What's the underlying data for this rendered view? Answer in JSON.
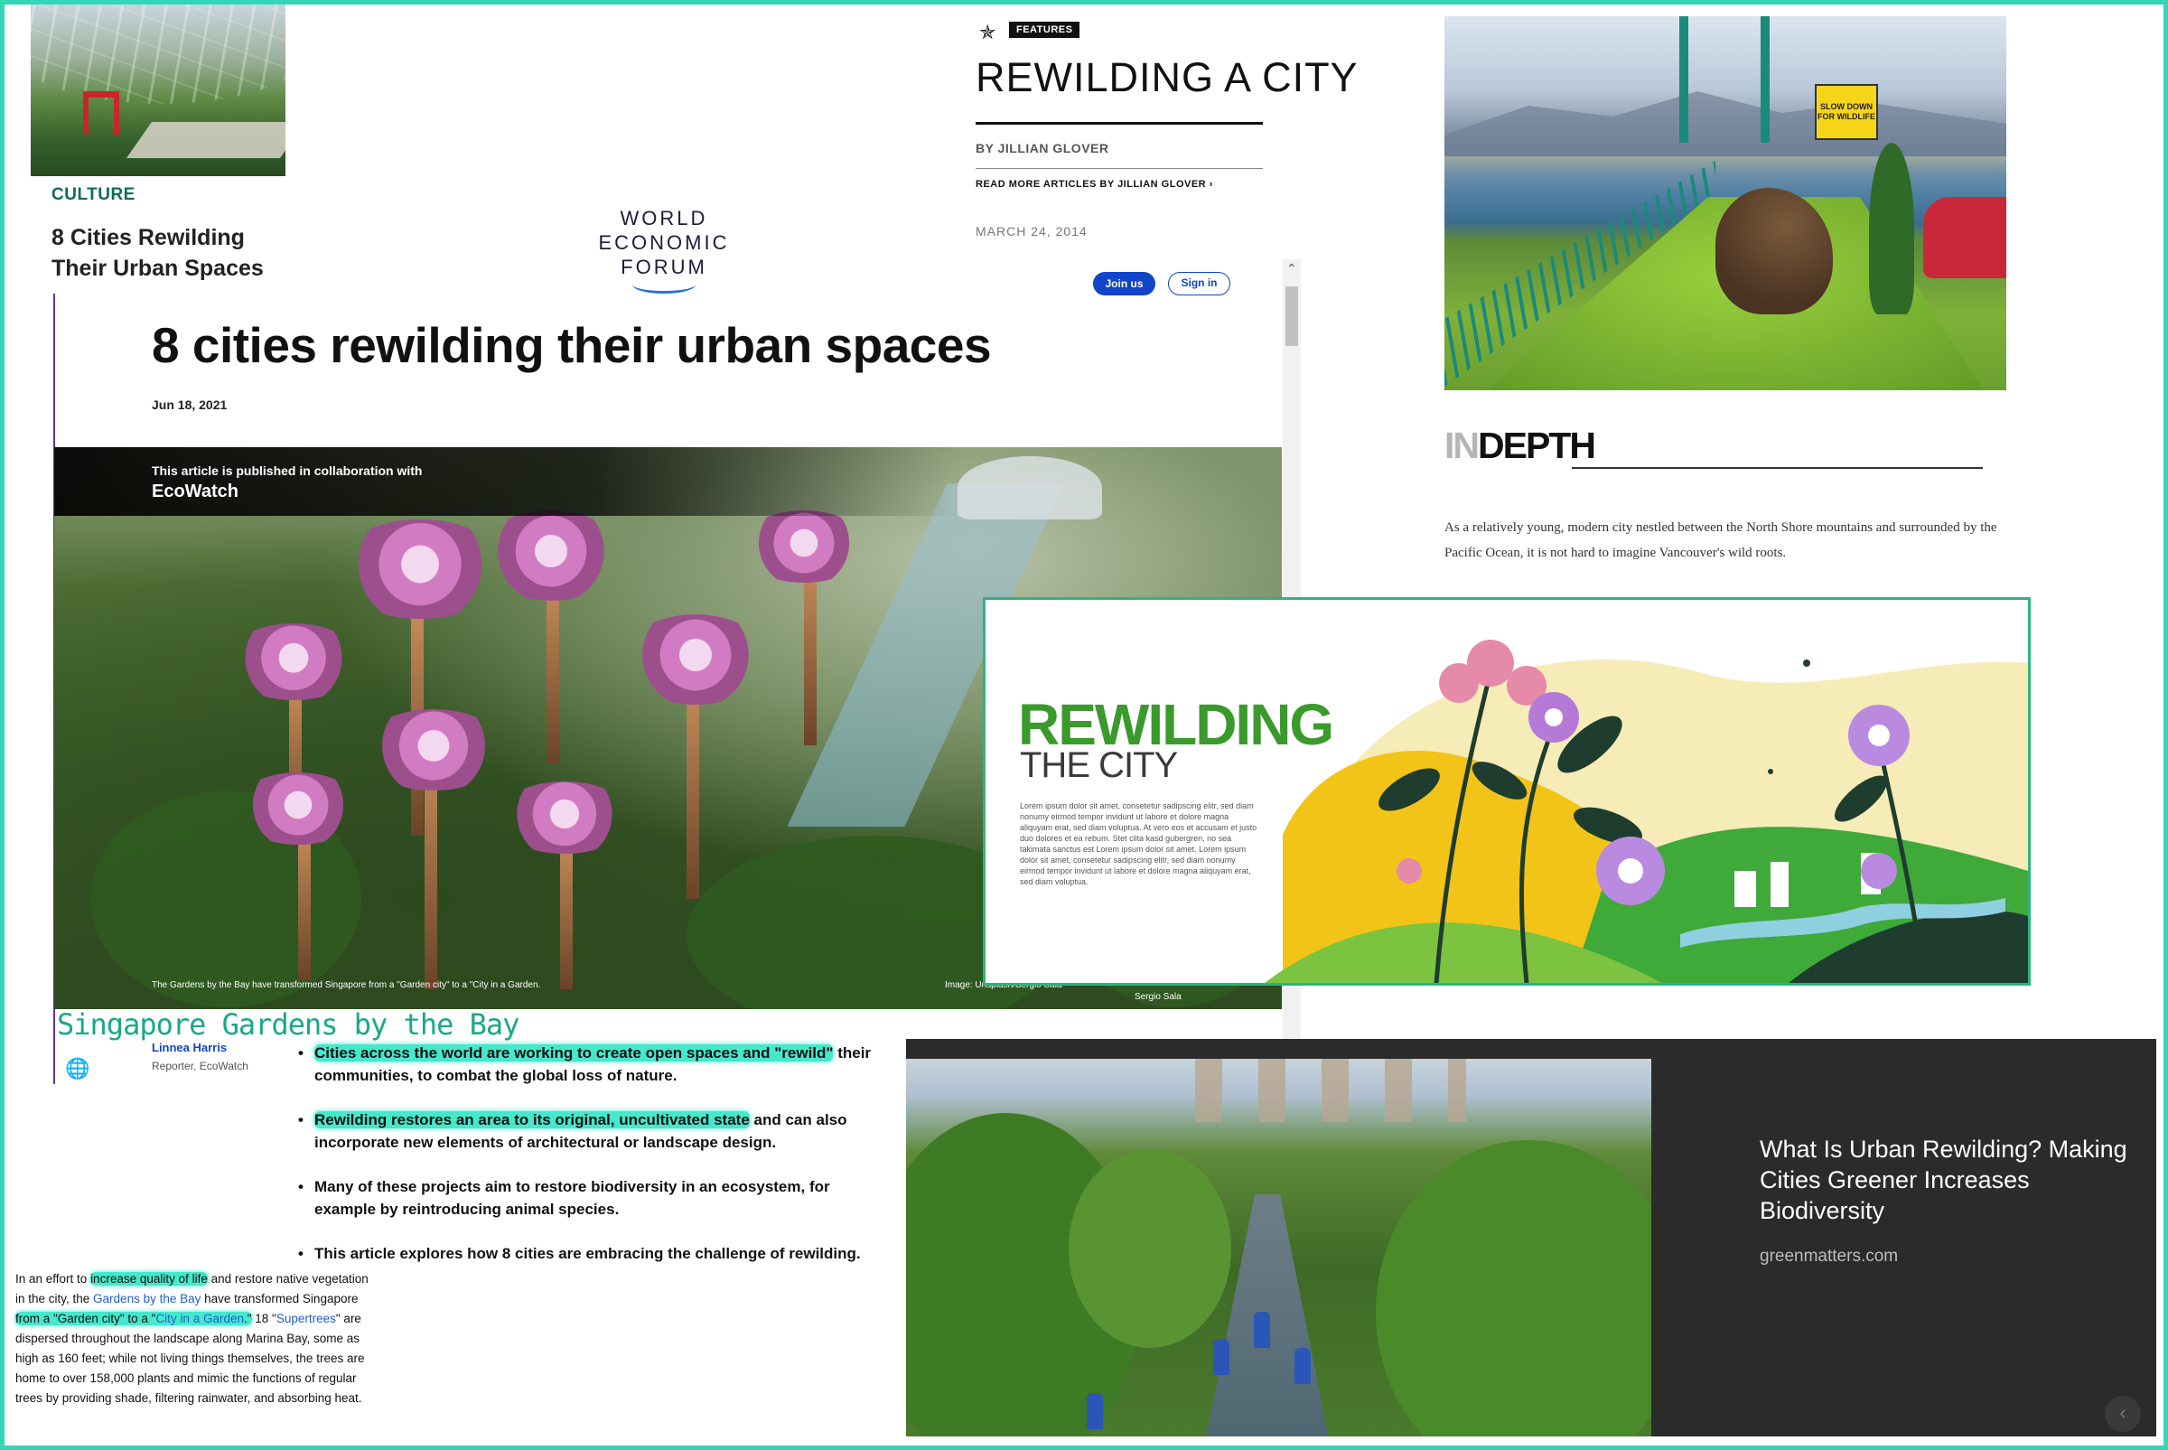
{
  "culture_card": {
    "label": "CULTURE",
    "title": "8 Cities Rewilding Their Urban Spaces"
  },
  "wef": {
    "logo_line1": "WORLD",
    "logo_line2": "ECONOMIC",
    "logo_line3": "FORUM",
    "join_label": "Join us",
    "sign_label": "Sign in",
    "title": "8 cities rewilding their urban spaces",
    "date": "Jun 18, 2021",
    "collab_label": "This article is published in collaboration with",
    "collab_name": "EcoWatch",
    "caption": "The Gardens by the Bay have transformed Singapore from a \"Garden city\" to a \"City in a Garden.",
    "credit": "Image: Unsplash/Sergio Sala",
    "credit2": "Sergio Sala",
    "author_name": "Linnea Harris",
    "author_role": "Reporter, EcoWatch",
    "bullets": [
      {
        "hl": "Cities across the world are working to create open spaces and \"rewild\"",
        "rest": " their communities, to combat the global loss of nature."
      },
      {
        "hl": "Rewilding restores an area to its original, uncultivated state",
        "rest": " and can also incorporate new elements of architectural or landscape design."
      },
      {
        "hl": "",
        "rest": "Many of these projects aim to restore biodiversity in an ecosystem, for example by reintroducing animal species."
      },
      {
        "hl": "",
        "rest": "This article explores how 8 cities are embracing the challenge of rewilding."
      }
    ]
  },
  "annotation": {
    "heading": "Singapore Gardens by the Bay"
  },
  "side_para": {
    "t1": "In an effort to ",
    "h1": "increase quality of life",
    "t2": " and restore native vegetation in the city, the ",
    "l1": "Gardens by the Bay",
    "t3": " have transformed Singapore ",
    "h2": "from a \"Garden city\" to a \"",
    "l2": "City in a Garden",
    "h3": ".\"",
    "t4": " 18 \"",
    "l3": "Supertrees",
    "t5": "\" are dispersed throughout the landscape along Marina Bay, some as high as 160 feet; while not living things themselves, the trees are home to over 158,000 plants and mimic the functions of regular trees by providing shade, filtering rainwater, and absorbing heat."
  },
  "feature": {
    "badge": "FEATURES",
    "title": "REWILDING A CITY",
    "byline": "BY JILLIAN GLOVER",
    "more": "READ MORE ARTICLES BY JILLIAN GLOVER ›",
    "date": "MARCH 24, 2014"
  },
  "indepth": {
    "in": "IN",
    "depth": "DEPTH",
    "text": "As a relatively young, modern city nestled between the North Shore mountains and surrounded by the Pacific Ocean, it is not hard to imagine Vancouver's wild roots.",
    "sign": "SLOW DOWN FOR WILDLIFE"
  },
  "rewilding_card": {
    "title1": "REWILDING",
    "title2": "THE CITY",
    "lorem": "Lorem ipsum dolor sit amet, consetetur sadipscing elitr, sed diam nonumy eirmod tempor invidunt ut labore et dolore magna aliquyam erat, sed diam voluptua. At vero eos et accusam et justo duo dolores et ea rebum. Stet clita kasd gubergren, no sea takimata sanctus est Lorem ipsum dolor sit amet. Lorem ipsum dolor sit amet, consetetur sadipscing elitr, sed diam nonumy eirmod tempor invidunt ut labore et dolore magna aliquyam erat, sed diam voluptua."
  },
  "greenmatters": {
    "title": "What Is Urban Rewilding? Making Cities Greener Increases Biodiversity",
    "source": "greenmatters.com",
    "prev_icon": "‹"
  },
  "colors": {
    "frame": "#34d6b8",
    "highlight": "#46e8cc",
    "wef_blue": "#1045c8",
    "rewild_green": "#3a9a2c",
    "culture_green": "#0f6b59"
  }
}
